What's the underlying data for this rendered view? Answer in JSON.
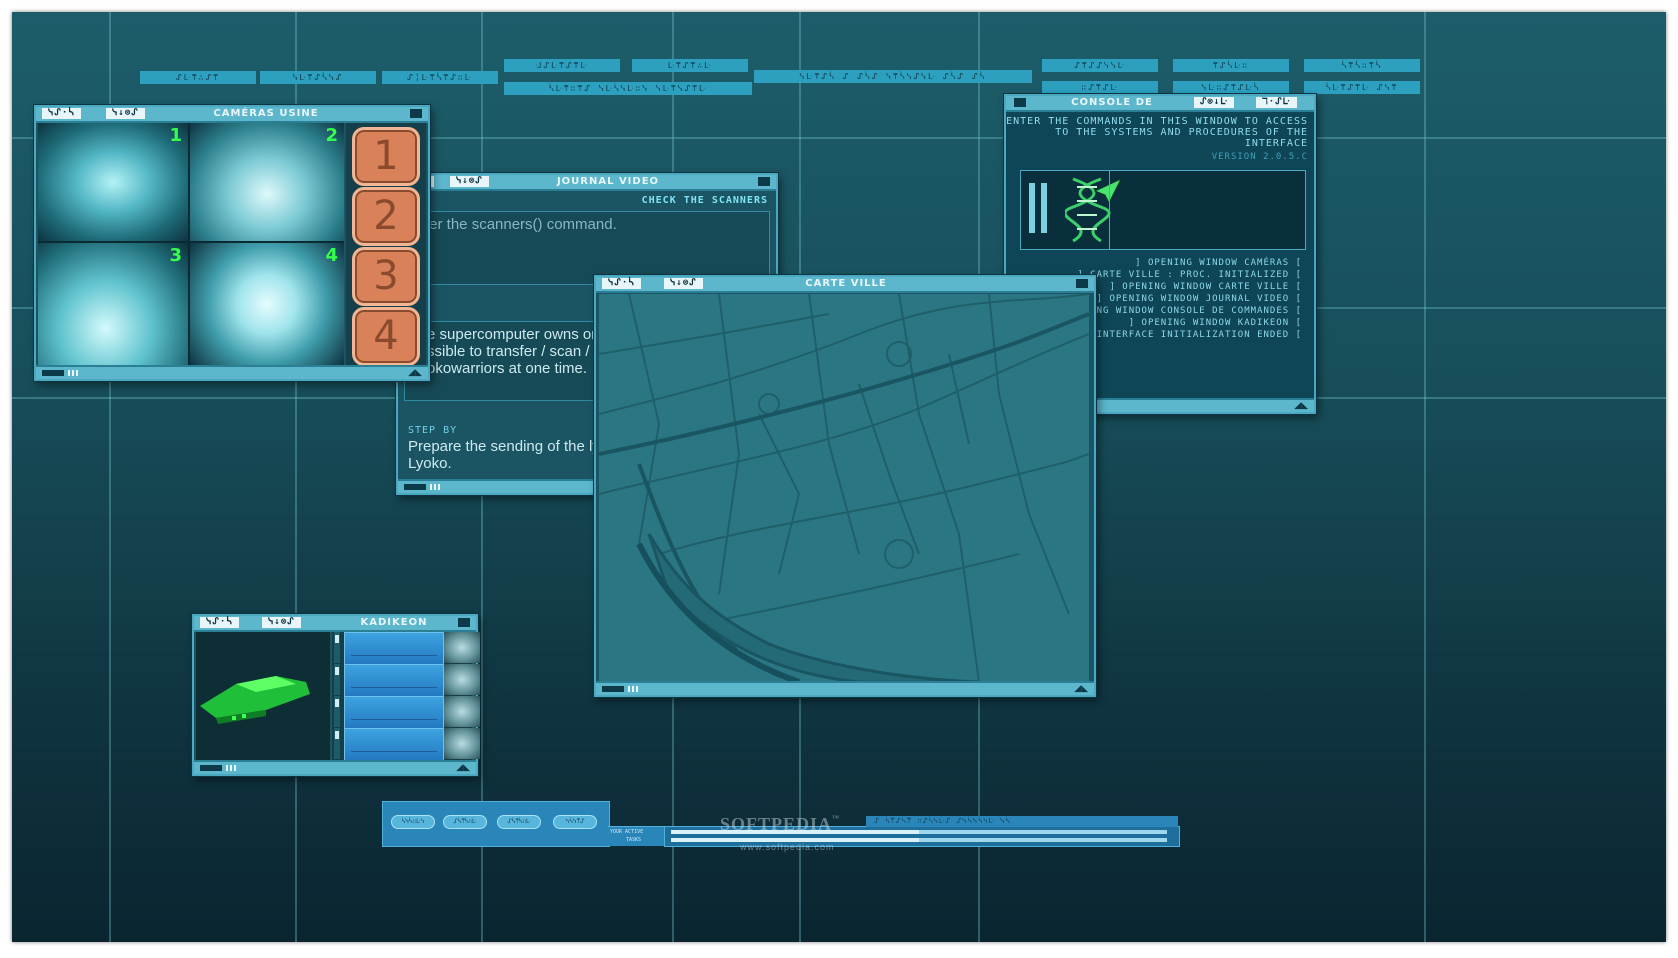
{
  "top_tags": {
    "row1": [
      "ᔑᒷ⍑∴ᔑ⍑",
      "ᓭᒷ⍑ᔑᓵᓭᔑ",
      "ᔑ╎ᒷ⍑ᓵ⍑ᔑ∷ᒷ",
      "ᒲᔑᒷ⍑ᔑ⍑ᒷ",
      "ᒷ⍑ᔑ⍑∴ᒷ",
      "ᓭᒷ⍑ᔑᓵ ᔑ ᔑᓵᔑ ᓭ⍑ᓵᓭᔑᓭᒷ ᔑᓵᔑ ᔑᓵ",
      "ᔑ⍑ᔑᔑᓭᓭᒷ",
      "⍑ᔑᓵᒷ∷",
      "ᓵ⍑ᓵ∷⍑ᓵ"
    ],
    "row2": [
      "ᓵᒷ⍑∷⍑ᔑ ᓭᒷᓵᓭᒷ∷ᓭ ᓭᒷ⍑ᓭᔑ⍑ᒷ",
      "∷ᔑ⍑ᔑᒷ",
      "ᓭᒷ∷ᔑ⍑ᔑᒷᓵ",
      "ᓵᒷ⍑ᔑ⍑ᒷ ᔑᓭ⍑"
    ]
  },
  "cameras": {
    "glyph_left": "ᓭᔑ·ᓵ",
    "glyph_mid": "ᓭ↓⊗ᔑ",
    "title": "CAMÉRAS USINE",
    "feed_numbers": [
      "1",
      "2",
      "3",
      "4"
    ],
    "buttons": [
      "1",
      "2",
      "3",
      "4"
    ]
  },
  "journal": {
    "glyph_left": "ᓵ",
    "glyph_mid": "ᓭ↓⊗ᔑ",
    "title": "JOURNAL VIDEO",
    "header_right": "CHECK THE SCANNERS",
    "text1": "ter the scanners() command.",
    "text2": "e supercomputer owns or",
    "text3": "ssible to transfer / scan / v",
    "text4": "okowarriors at one time.",
    "step_label": "STEP BY",
    "step_text1": "Prepare the sending of the ly",
    "step_text2": "Lyoko."
  },
  "carte": {
    "glyph_left": "ᓭᔑ·ᓵ",
    "glyph_mid": "ᓭ↓⊗ᔑ",
    "title": "CARTE VILLE"
  },
  "console": {
    "title": "CONSOLE DE COMMANDES",
    "glyph_mid": "ᔑ⊗↓ᒷ",
    "glyph_right": "ℸ·ᔑᒷ",
    "intro1": "ENTER THE COMMANDS IN THIS WINDOW TO ACCESS",
    "intro2": "TO THE SYSTEMS AND PROCEDURES OF THE",
    "intro3": "INTERFACE",
    "version": "VERSION 2.0.5.C",
    "log": [
      "] OPENING WINDOW CAMÉRAS [",
      "] CARTE VILLE : PROC. INITIALIZED [",
      "] OPENING WINDOW CARTE VILLE [",
      "] OPENING WINDOW JOURNAL VIDEO [",
      "ENING WINDOW CONSOLE DE COMMANDES [",
      "] OPENING WINDOW KADIKEON [",
      "] INTERFACE INITIALIZATION ENDED ["
    ]
  },
  "kadikeon": {
    "glyph_left": "ᓭᔑ·ᓵ",
    "glyph_mid": "ᓭ↓⊗ᔑ",
    "title": "KADIKEON"
  },
  "taskbar": {
    "buttons": [
      "ᓵᓭᓵ∷ᒷᓭ",
      "ᔑᓵ⍑ᓵ∷ᒷ",
      "ᔑᓵ⍑ᓵ∷ᒷ",
      "ᓭᓵᓭ⍑ᔑ"
    ],
    "side_label1": "YOUR ACTIVE",
    "side_label2": "TASKS",
    "right_strip": "ᔑ  ᓵ⍑ᔑᓵ⍑  ∷ᔑᓵᓭᒷᔑ  ᔑᓭᓵᓭᓵᓭᒷ  ᓭᓵ"
  },
  "watermark": {
    "brand": "SOFTPEDIA",
    "tm": "™",
    "url": "www.softpedia.com"
  },
  "colors": {
    "background": "#174e5a",
    "window_frame": "#5cb6cc",
    "accent_orange": "#d9825a",
    "camera_number_green": "#35ff4a"
  }
}
